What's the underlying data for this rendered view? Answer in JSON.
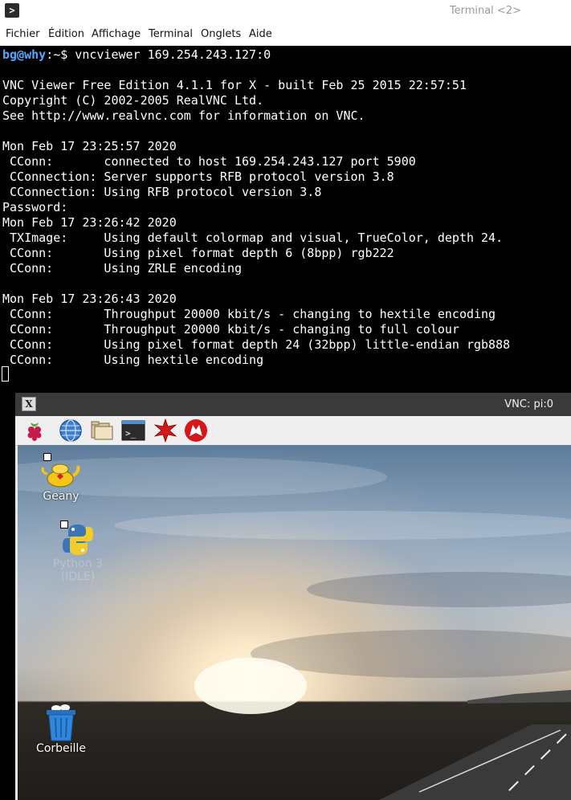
{
  "terminal": {
    "title": "Terminal <2>",
    "menu": [
      "Fichier",
      "Édition",
      "Affichage",
      "Terminal",
      "Onglets",
      "Aide"
    ],
    "prompt_user": "bg@why",
    "prompt_rest": ":~$ vncviewer 169.254.243.127:0",
    "lines": [
      "VNC Viewer Free Edition 4.1.1 for X - built Feb 25 2015 22:57:51",
      "Copyright (C) 2002-2005 RealVNC Ltd.",
      "See http://www.realvnc.com for information on VNC.",
      "",
      "Mon Feb 17 23:25:57 2020",
      " CConn:       connected to host 169.254.243.127 port 5900",
      " CConnection: Server supports RFB protocol version 3.8",
      " CConnection: Using RFB protocol version 3.8",
      "Password:",
      "Mon Feb 17 23:26:42 2020",
      " TXImage:     Using default colormap and visual, TrueColor, depth 24.",
      " CConn:       Using pixel format depth 6 (8bpp) rgb222",
      " CConn:       Using ZRLE encoding",
      "",
      "Mon Feb 17 23:26:43 2020",
      " CConn:       Throughput 20000 kbit/s - changing to hextile encoding",
      " CConn:       Throughput 20000 kbit/s - changing to full colour",
      " CConn:       Using pixel format depth 24 (32bpp) little-endian rgb888",
      " CConn:       Using hextile encoding"
    ]
  },
  "vnc": {
    "title": "VNC: pi:0",
    "panel_icons": [
      "raspberry-menu-icon",
      "web-browser-icon",
      "file-manager-icon",
      "terminal-icon",
      "mathematica-icon",
      "wolfram-icon"
    ],
    "desktop_icons": [
      {
        "label": "Geany",
        "icon": "geany-teapot-icon"
      },
      {
        "label": "Python 3 (IDLE)",
        "icon": "python-icon"
      },
      {
        "label": "Corbeille",
        "icon": "trash-icon"
      }
    ]
  }
}
